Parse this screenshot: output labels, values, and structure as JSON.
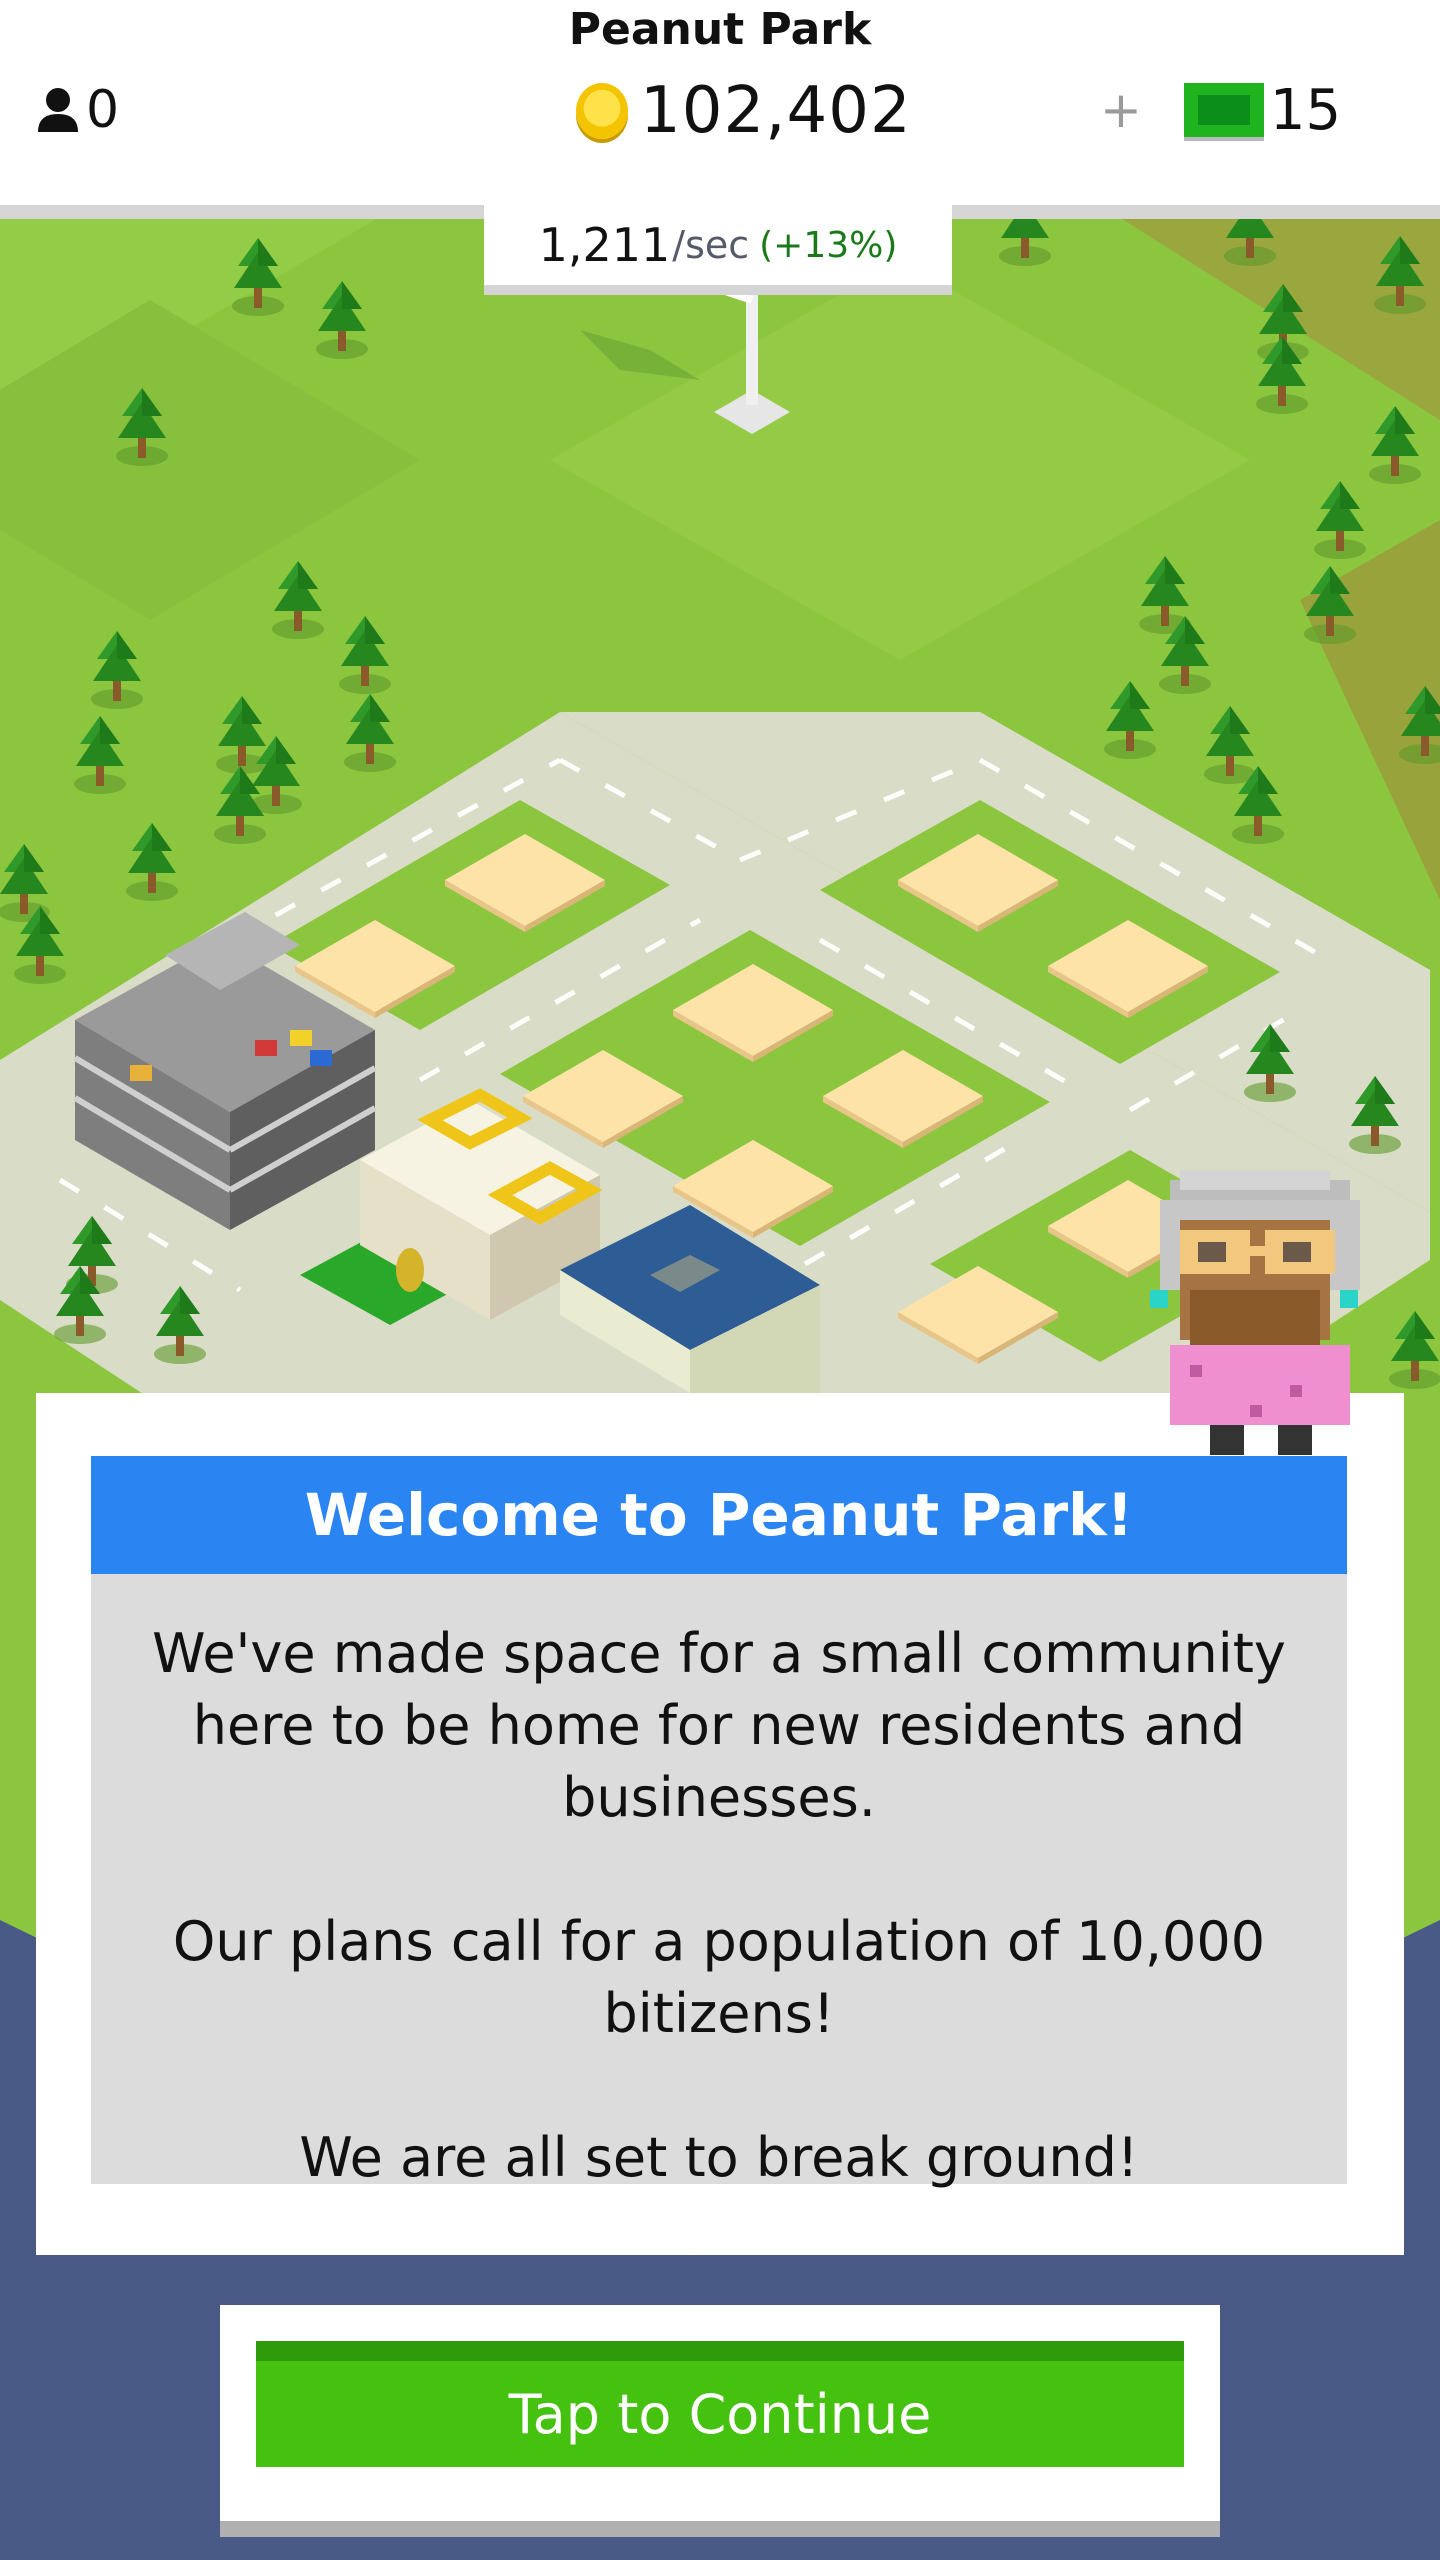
{
  "hud": {
    "park_name": "Peanut Park",
    "population": "0",
    "coins": "102,402",
    "cash_plus": "+",
    "cash": "15"
  },
  "rate": {
    "value": "1,211",
    "unit": "/sec",
    "percent": "(+13%)"
  },
  "dialog": {
    "title": "Welcome to Peanut Park!",
    "paragraphs": [
      "We've made space for a small community here to be home for new residents and businesses.",
      "Our plans call for a population of 10,000 bitizens!",
      "We are all set to break ground!"
    ]
  },
  "continue": {
    "label": "Tap to Continue"
  },
  "colors": {
    "grass": "#8cc63f",
    "road": "#d9dcc6",
    "lot": "#fde3a7",
    "header_blue": "#2a84f2",
    "button_green": "#45c110",
    "backdrop": "#4a5a87"
  }
}
